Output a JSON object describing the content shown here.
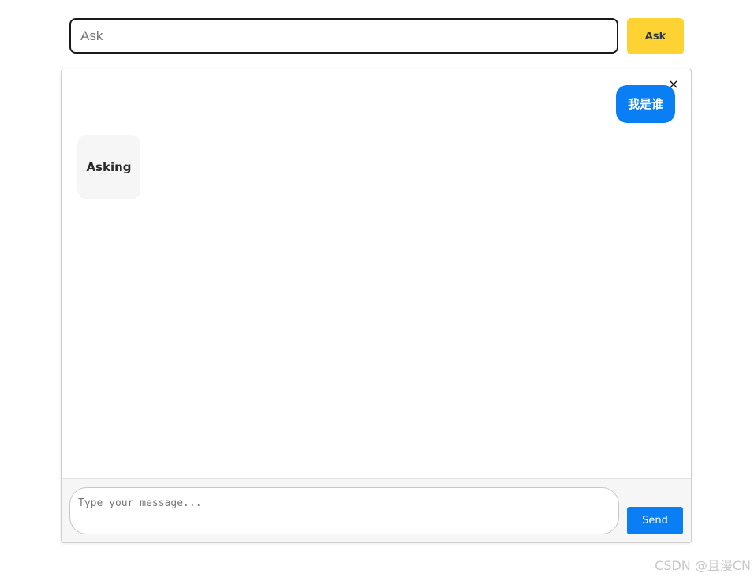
{
  "ask_bar": {
    "input_value": "",
    "input_placeholder": "Ask",
    "button_label": "Ask"
  },
  "chat": {
    "close_label": "×",
    "messages": [
      {
        "role": "user",
        "text": "我是谁"
      },
      {
        "role": "assistant",
        "text": "Asking"
      }
    ],
    "compose": {
      "placeholder": "Type your message...",
      "value": "",
      "send_label": "Send"
    }
  },
  "watermark": {
    "text": "CSDN @且漫CN"
  },
  "colors": {
    "ask_button": "#fed233",
    "user_bubble": "#0a7ff5",
    "send_button": "#0a7ff5",
    "bot_bubble": "#f6f6f6",
    "footer_background": "#f6f6f6"
  }
}
